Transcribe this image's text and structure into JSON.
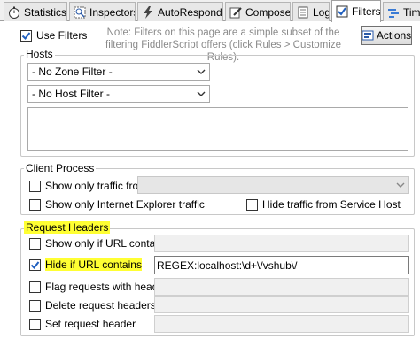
{
  "tabs": [
    {
      "label": "Statistics",
      "icon": "stopwatch-icon"
    },
    {
      "label": "Inspectors",
      "icon": "inspect-icon"
    },
    {
      "label": "AutoResponder",
      "icon": "lightning-icon"
    },
    {
      "label": "Composer",
      "icon": "pencil-icon"
    },
    {
      "label": "Log",
      "icon": "document-icon"
    },
    {
      "label": "Filters",
      "icon": "checkbox-icon",
      "active": true
    },
    {
      "label": "Time",
      "icon": "timeline-icon"
    }
  ],
  "use_filters": {
    "label": "Use Filters",
    "checked": true
  },
  "note": "Note: Filters on this page are a simple subset of the filtering FiddlerScript offers (click Rules > Customize Rules).",
  "actions_label": "Actions",
  "hosts": {
    "legend": "Hosts",
    "zone_filter": "- No Zone Filter -",
    "host_filter": "- No Host Filter -",
    "host_list": ""
  },
  "client_process": {
    "legend": "Client Process",
    "show_only_traffic_from": {
      "label": "Show only traffic from",
      "checked": false,
      "value": ""
    },
    "show_only_ie": {
      "label": "Show only Internet Explorer traffic",
      "checked": false
    },
    "hide_service_host": {
      "label": "Hide traffic from Service Host",
      "checked": false
    }
  },
  "request_headers": {
    "legend": "Request Headers",
    "show_if_url": {
      "label": "Show only if URL contains",
      "checked": false,
      "value": ""
    },
    "hide_if_url": {
      "label": "Hide if URL contains",
      "checked": true,
      "value": "REGEX:localhost:\\d+\\/vshub\\/"
    },
    "flag_requests": {
      "label": "Flag requests with headers",
      "checked": false,
      "value": ""
    },
    "delete_headers": {
      "label": "Delete request headers",
      "checked": false,
      "value": ""
    },
    "set_header": {
      "label": "Set request header",
      "checked": false,
      "value": ""
    }
  },
  "colors": {
    "highlight": "#ffff33",
    "accent_check": "#1f5fbf"
  }
}
